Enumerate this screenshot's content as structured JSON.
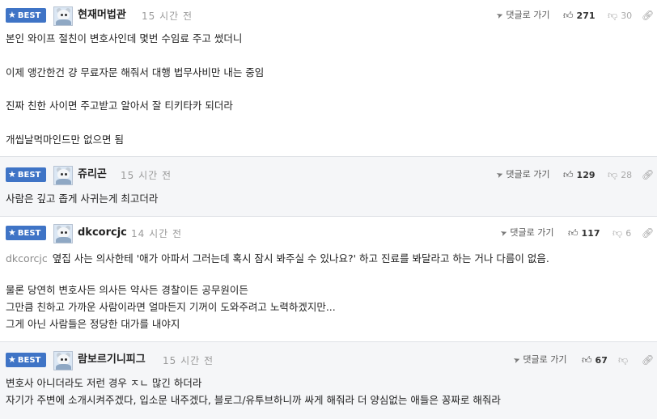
{
  "labels": {
    "badge": "BEST",
    "reply": "댓글로 가기"
  },
  "icons": {
    "badge": "star-icon",
    "reply": "send-arrow-icon",
    "upvote": "thumbs-up-icon",
    "downvote": "thumbs-down-icon",
    "link": "link-icon"
  },
  "colors": {
    "badge": "#3f74c6",
    "alt_background": "#f5f6f8",
    "mention": "#8c8c8c"
  },
  "comments": [
    {
      "nickname": "현재머법관",
      "time": "15 시간 전",
      "upvotes": "271",
      "downvotes": "30",
      "lines": [
        "본인 와이프 절친이 변호사인데 몇번 수임료 주고 썼더니",
        "",
        "이제 앵간한건 걍 무료자문 해줘서 대행 법무사비만 내는 중임",
        "",
        "진짜 친한 사이면 주고받고 알아서 잘 티키타카 되더라",
        "",
        "개씹날먹마인드만 없으면 됨"
      ]
    },
    {
      "nickname": "쥬리곤",
      "time": "15 시간 전",
      "upvotes": "129",
      "downvotes": "28",
      "lines": [
        "사람은 깊고 좁게 사귀는게 최고더라"
      ]
    },
    {
      "nickname": "dkcorcjc",
      "time": "14 시간 전",
      "upvotes": "117",
      "downvotes": "6",
      "mention": "dkcorcjc",
      "lines": [
        "옆집 사는 의사한테 '애가 아파서 그러는데 혹시 잠시 봐주실 수 있나요?' 하고 진료를 봐달라고 하는 거나 다름이 없음.",
        "",
        "물론 당연히 변호사든 의사든 약사든 경찰이든 공무원이든",
        "그만큼 친하고 가까운 사람이라면 얼마든지 기꺼이 도와주려고 노력하겠지만...",
        "그게 아닌 사람들은 정당한 대가를 내야지"
      ]
    },
    {
      "nickname": "람보르기니피그",
      "time": "15 시간 전",
      "upvotes": "67",
      "downvotes": "",
      "lines": [
        "변호사 아니더라도 저런 경우 ㅈㄴ 많긴 하더라",
        "자기가 주변에 소개시켜주겠다, 입소문 내주겠다, 블로그/유투브하니까 싸게 해줘라 더 양심없는 애들은 꽁짜로 해줘라"
      ]
    }
  ]
}
